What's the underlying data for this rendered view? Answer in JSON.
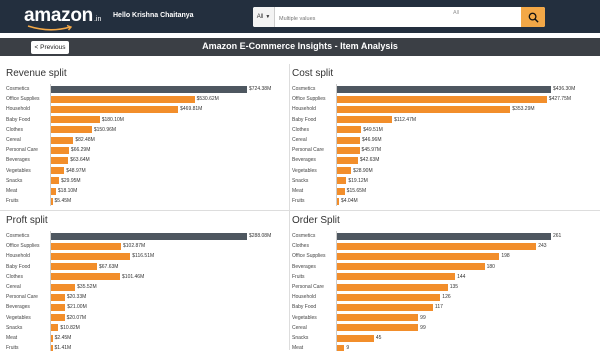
{
  "header": {
    "logo_text": "amazon",
    "logo_suffix": ".in",
    "greeting": "Hello Krishna Chaitanya",
    "search": {
      "category": "All",
      "placeholder": "Multiple values",
      "scope_text": "All"
    }
  },
  "titlebar": {
    "prev_label": "< Previous",
    "title": "Amazon E-Commerce Insights - Item Analysis"
  },
  "colors": {
    "topbar": "#232f3e",
    "bar": "#f28e2b",
    "top_bar": "#4e5760",
    "search_button": "#f3a847"
  },
  "icons": {
    "search": "search-icon",
    "logo_smile": "amazon-smile-icon"
  },
  "chart_data": [
    {
      "type": "bar",
      "orientation": "horizontal",
      "title": "Revenue split",
      "unit": "$M",
      "categories": [
        "Cosmetics",
        "Office Supplies",
        "Household",
        "Baby Food",
        "Clothes",
        "Cereal",
        "Personal Care",
        "Beverages",
        "Vegetables",
        "Snacks",
        "Meat",
        "Fruits"
      ],
      "values": [
        724.38,
        530.62,
        469.81,
        180.1,
        150.96,
        82.48,
        66.29,
        63.64,
        48.97,
        29.95,
        18.1,
        5.45
      ],
      "labels": [
        "$724.38M",
        "$530.62M",
        "$469.81M",
        "$180.10M",
        "$150.96M",
        "$82.48M",
        "$66.29M",
        "$63.64M",
        "$48.97M",
        "$29.95M",
        "$18.10M",
        "$5.45M"
      ],
      "xlim": [
        0,
        724.38
      ]
    },
    {
      "type": "bar",
      "orientation": "horizontal",
      "title": "Cost split",
      "unit": "$M",
      "categories": [
        "Cosmetics",
        "Office Supplies",
        "Household",
        "Baby Food",
        "Clothes",
        "Cereal",
        "Personal Care",
        "Beverages",
        "Vegetables",
        "Snacks",
        "Meat",
        "Fruits"
      ],
      "values": [
        436.3,
        427.75,
        353.29,
        112.47,
        49.51,
        46.96,
        45.97,
        42.63,
        28.9,
        19.12,
        15.65,
        4.04
      ],
      "labels": [
        "$436.30M",
        "$427.75M",
        "$353.29M",
        "$112.47M",
        "$49.51M",
        "$46.96M",
        "$45.97M",
        "$42.63M",
        "$28.90M",
        "$19.12M",
        "$15.65M",
        "$4.04M"
      ],
      "xlim": [
        0,
        436.3
      ]
    },
    {
      "type": "bar",
      "orientation": "horizontal",
      "title": "Proft split",
      "unit": "$M",
      "categories": [
        "Cosmetics",
        "Office Supplies",
        "Household",
        "Baby Food",
        "Clothes",
        "Cereal",
        "Personal Care",
        "Beverages",
        "Vegetables",
        "Snacks",
        "Meat",
        "Fruits"
      ],
      "values": [
        288.08,
        102.87,
        116.51,
        67.63,
        101.46,
        35.52,
        20.33,
        21.0,
        20.07,
        10.82,
        2.45,
        1.41
      ],
      "labels": [
        "$288.08M",
        "$102.87M",
        "$116.51M",
        "$67.63M",
        "$101.46M",
        "$35.52M",
        "$20.33M",
        "$21.00M",
        "$20.07M",
        "$10.82M",
        "$2.45M",
        "$1.41M"
      ],
      "xlim": [
        0,
        288.08
      ]
    },
    {
      "type": "bar",
      "orientation": "horizontal",
      "title": "Order Split",
      "categories": [
        "Cosmetics",
        "Clothes",
        "Office Supplies",
        "Beverages",
        "Fruits",
        "Personal Care",
        "Household",
        "Baby Food",
        "Vegetables",
        "Cereal",
        "Snacks",
        "Meat"
      ],
      "values": [
        261,
        243,
        198,
        180,
        144,
        135,
        126,
        117,
        99,
        99,
        45,
        9
      ],
      "labels": [
        "261",
        "243",
        "198",
        "180",
        "144",
        "135",
        "126",
        "117",
        "99",
        "99",
        "45",
        "9"
      ],
      "xlim": [
        0,
        261
      ]
    }
  ]
}
